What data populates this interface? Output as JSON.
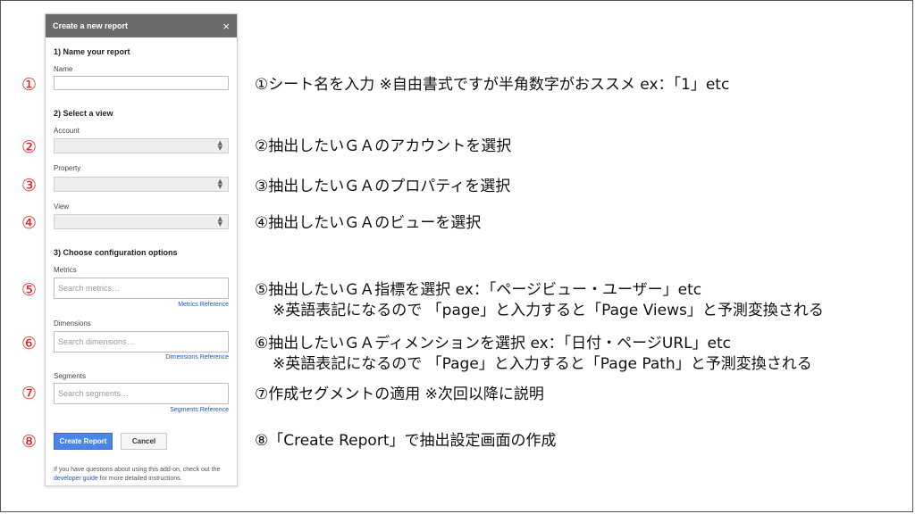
{
  "panel": {
    "title": "Create a new report",
    "close": "×",
    "section1": "1) Name your report",
    "name_label": "Name",
    "section2": "2) Select a view",
    "account_label": "Account",
    "property_label": "Property",
    "view_label": "View",
    "section3": "3) Choose configuration options",
    "metrics_label": "Metrics",
    "metrics_placeholder": "Search metrics…",
    "metrics_ref": "Metrics Reference",
    "dimensions_label": "Dimensions",
    "dimensions_placeholder": "Search dimensions…",
    "dimensions_ref": "Dimensions Reference",
    "segments_label": "Segments",
    "segments_placeholder": "Search segments…",
    "segments_ref": "Segments Reference",
    "create_button": "Create Report",
    "cancel_button": "Cancel",
    "footer_text1": "If you have questions about using this add-on, check out the ",
    "footer_link": "developer guide",
    "footer_text2": " for more detailed instructions."
  },
  "markers": [
    "①",
    "②",
    "③",
    "④",
    "⑤",
    "⑥",
    "⑦",
    "⑧"
  ],
  "descriptions": {
    "d1": "①シート名を入力 ※自由書式ですが半角数字がおススメ ex：「1」etc",
    "d2": "②抽出したいＧＡのアカウントを選択",
    "d3": "③抽出したいＧＡのプロパティを選択",
    "d4": "④抽出したいＧＡのビューを選択",
    "d5a": "⑤抽出したいＧＡ指標を選択 ex：「ページビュー・ユーザー」etc",
    "d5b": "※英語表記になるので 「page」と入力すると「Page Views」と予測変換される",
    "d6a": "⑥抽出したいＧＡディメンションを選択 ex：「日付・ページURL」etc",
    "d6b": "※英語表記になるので 「Page」と入力すると「Page Path」と予測変換される",
    "d7": "⑦作成セグメントの適用 ※次回以降に説明",
    "d8": "⑧「Create Report」で抽出設定画面の作成"
  },
  "colors": {
    "marker": "#e02020",
    "primary_button": "#4a86e8",
    "link": "#1a57c8",
    "header": "#6b6b6b"
  }
}
